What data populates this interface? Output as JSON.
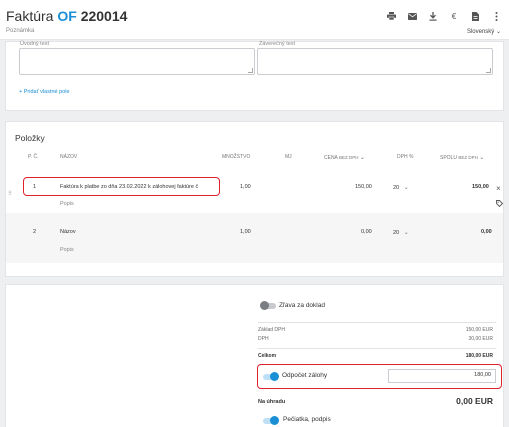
{
  "header": {
    "title_prefix": "Faktúra",
    "title_of": "OF",
    "title_number": "220014",
    "subtitle": "Poznámka",
    "language": "Slovenský",
    "language_chevron": "⌄",
    "icons": [
      "print-icon",
      "email-icon",
      "download-icon",
      "euro-icon",
      "document-icon",
      "more-vertical-icon"
    ]
  },
  "notes": {
    "intro_label": "Úvodný text",
    "closing_label": "Záverečný text",
    "add_field": "+ Pridať vlastné pole"
  },
  "items": {
    "title": "Položky",
    "columns": {
      "num": "P. Č.",
      "name": "NÁZOV",
      "qty": "MNOŽSTVO",
      "unit": "MJ",
      "price": "CENA",
      "price_sub": "BEZ DPH",
      "vat": "DPH %",
      "total": "SPOLU",
      "total_sub": "BEZ DPH"
    },
    "rows": [
      {
        "num": "1",
        "name": "Faktúra k platbe zo dňa 23.02.2022 k zálohovej faktúre č",
        "desc": "Popis",
        "qty": "1,00",
        "price": "150,00",
        "vat": "20",
        "total": "150,00"
      },
      {
        "num": "2",
        "name": "Názov",
        "desc": "Popis",
        "qty": "1,00",
        "price": "0,00",
        "vat": "20",
        "total": "0,00"
      }
    ]
  },
  "summary": {
    "discount_label": "Zľava za doklad",
    "base_label": "Základ DPH",
    "base_value": "150,00 EUR",
    "vat_label": "DPH",
    "vat_value": "30,00 EUR",
    "total_label": "Celkom",
    "total_value": "180,00 EUR",
    "advance_label": "Odpočet zálohy",
    "advance_value": "180,00",
    "due_label": "Na úhradu",
    "due_value": "0,00 EUR",
    "stamp_label": "Pečiatka, podpis"
  },
  "colors": {
    "accent": "#1a8fd6",
    "highlight": "#e0212b"
  }
}
